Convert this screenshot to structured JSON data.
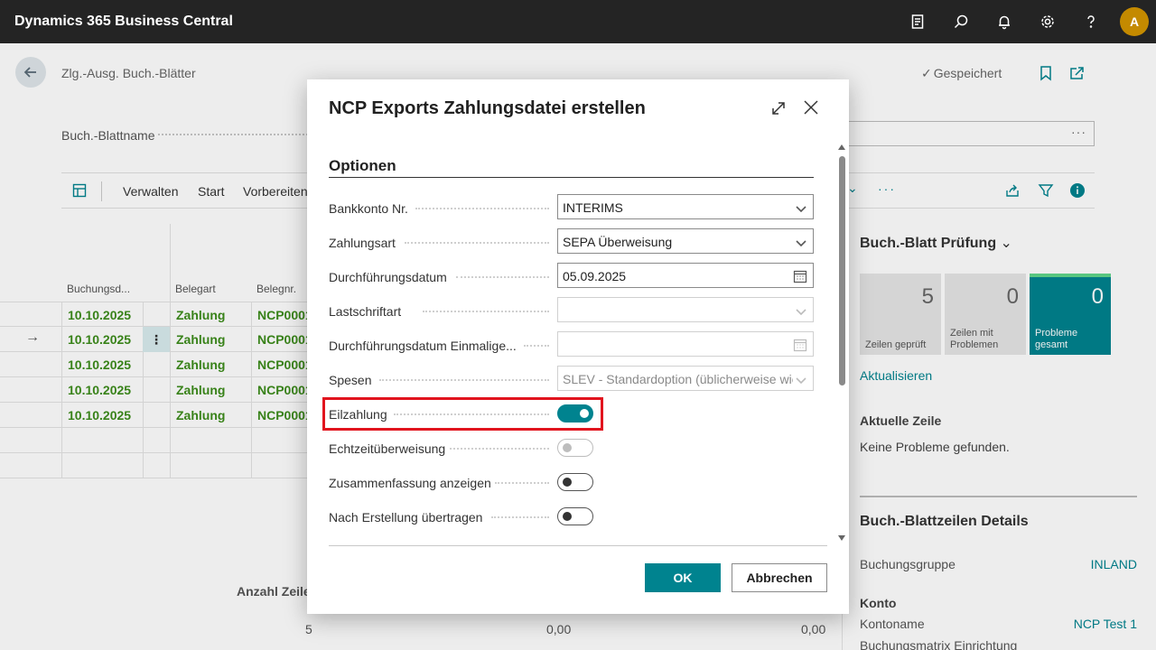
{
  "topbar": {
    "app_title": "Dynamics 365 Business Central",
    "avatar_initial": "A"
  },
  "page": {
    "breadcrumb": "Zlg.-Ausg. Buch.-Blätter",
    "saved_status": "Gespeichert",
    "journal_name_label": "Buch.-Blattname",
    "journal_more": "···",
    "actions": [
      "Verwalten",
      "Start",
      "Vorbereiten"
    ],
    "more_actions": "···",
    "grid": {
      "headers": [
        "Buchungsd...",
        "Belegart",
        "Belegnr."
      ],
      "rows": [
        {
          "date": "10.10.2025",
          "doc_type": "Zahlung",
          "doc_no": "NCP0001"
        },
        {
          "date": "10.10.2025",
          "doc_type": "Zahlung",
          "doc_no": "NCP0001"
        },
        {
          "date": "10.10.2025",
          "doc_type": "Zahlung",
          "doc_no": "NCP0001"
        },
        {
          "date": "10.10.2025",
          "doc_type": "Zahlung",
          "doc_no": "NCP0001"
        },
        {
          "date": "10.10.2025",
          "doc_type": "Zahlung",
          "doc_no": "NCP0001"
        }
      ],
      "current_row_arrow": "→",
      "row_menu": "⋮"
    },
    "footer": {
      "count_label": "Anzahl Zeile",
      "count": "5",
      "sum1": "0,00",
      "sum2": "0,00"
    }
  },
  "right_pane": {
    "title": "Buch.-Blatt Prüfung",
    "tiles": [
      {
        "value": "5",
        "label": "Zeilen geprüft"
      },
      {
        "value": "0",
        "label": "Zeilen mit Problemen"
      },
      {
        "value": "0",
        "label": "Probleme gesamt"
      }
    ],
    "refresh_link": "Aktualisieren",
    "current_line_title": "Aktuelle Zeile",
    "current_line_text": "Keine Probleme gefunden.",
    "details_title": "Buch.-Blattzeilen Details",
    "posting_group_label": "Buchungsgruppe",
    "posting_group_value": "INLAND",
    "account_title": "Konto",
    "account_name_label": "Kontoname",
    "account_name_value": "NCP Test 1",
    "matrix_label": "Buchungsmatrix Einrichtung"
  },
  "dialog": {
    "title": "NCP Exports Zahlungsdatei erstellen",
    "section": "Optionen",
    "fields": {
      "bank_account": {
        "label": "Bankkonto Nr.",
        "value": "INTERIMS"
      },
      "payment_type": {
        "label": "Zahlungsart",
        "value": "SEPA Überweisung"
      },
      "execution_date": {
        "label": "Durchführungsdatum",
        "value": "05.09.2025"
      },
      "direct_debit_type": {
        "label": "Lastschriftart",
        "value": ""
      },
      "single_execution_date": {
        "label": "Durchführungsdatum Einmalige...",
        "value": ""
      },
      "charges": {
        "label": "Spesen",
        "value": "SLEV - Standardoption (üblicherweise wie"
      }
    },
    "toggles": {
      "urgent": {
        "label": "Eilzahlung",
        "on": true
      },
      "instant": {
        "label": "Echtzeitüberweisung",
        "on": false
      },
      "summary": {
        "label": "Zusammenfassung anzeigen",
        "on": false
      },
      "transfer": {
        "label": "Nach Erstellung übertragen",
        "on": false
      }
    },
    "ok_label": "OK",
    "cancel_label": "Abbrechen"
  },
  "colors": {
    "accent": "#00838f",
    "highlight": "#e1141e",
    "topbar": "#242424",
    "positive": "#3d8c1b"
  }
}
